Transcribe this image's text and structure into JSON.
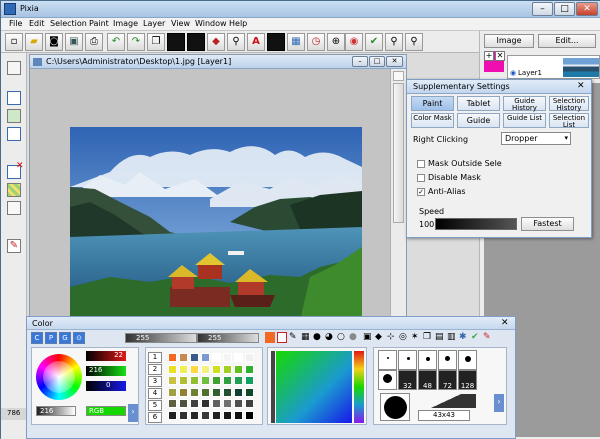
{
  "app": {
    "title": "Pixia"
  },
  "window_controls": {
    "minimize": "–",
    "maximize": "□",
    "close": "✕"
  },
  "menu": [
    "File",
    "Edit",
    "Selection",
    "Paint",
    "Image",
    "Layer",
    "View",
    "Window",
    "Help"
  ],
  "layers_panel": {
    "image_button": "Image",
    "edit_button": "Edit...",
    "layer_name": "Layer1"
  },
  "document": {
    "title": "C:\\Users\\Administrator\\Desktop\\1.jpg [Layer1]"
  },
  "supplementary": {
    "title": "Supplementary Settings",
    "tabs_row1": [
      "Paint",
      "Tablet",
      "Guide History",
      "Selection History"
    ],
    "tabs_row2": [
      "Color Mask",
      "Guide",
      "Guide List",
      "Selection List"
    ],
    "selected_tab": "Paint",
    "right_click_label": "Right Clicking",
    "right_click_value": "Dropper",
    "checkboxes": [
      {
        "label": "Mask Outside Sele",
        "checked": false
      },
      {
        "label": "Disable Mask",
        "checked": false
      },
      {
        "label": "Anti-Alias",
        "checked": true
      }
    ],
    "speed_label": "Speed",
    "speed_value": "100",
    "speed_button": "Fastest"
  },
  "color_panel": {
    "title": "Color",
    "mode_buttons": [
      "C",
      "P",
      "G",
      "⊙"
    ],
    "slider_values": [
      "255",
      "255"
    ],
    "rgb_values": [
      "22",
      "216",
      "0"
    ],
    "brightness_value": "216",
    "mode_label": "RGB",
    "palette_tabs": [
      "1",
      "2",
      "3",
      "4",
      "5",
      "6"
    ],
    "brush_sizes": [
      "32",
      "48",
      "72",
      "128"
    ],
    "brush_size_readout": "43x43"
  },
  "status": {
    "left_text": "786"
  },
  "colors": {
    "accent": "#3a78d8",
    "title_bar": "#b9d1ec",
    "red": "#d01010",
    "green": "#16d800"
  }
}
